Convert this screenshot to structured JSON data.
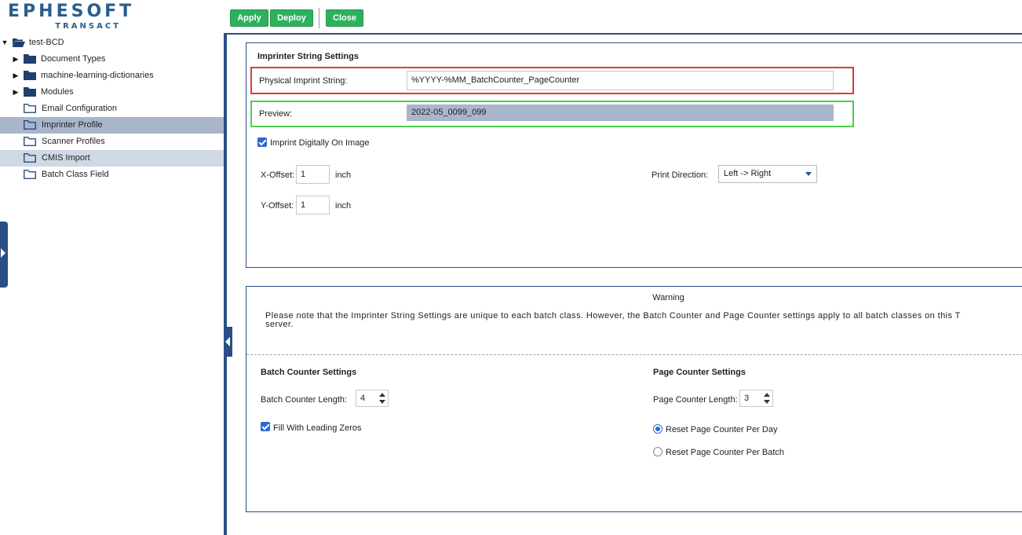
{
  "logo": {
    "word": "EPHESOFT",
    "sub": "TRANSACT"
  },
  "tree": {
    "root": "test-BCD",
    "items": [
      {
        "label": "Document Types",
        "expandable": true
      },
      {
        "label": "machine-learning-dictionaries",
        "expandable": true
      },
      {
        "label": "Modules",
        "expandable": true
      },
      {
        "label": "Email Configuration",
        "expandable": false
      },
      {
        "label": "Imprinter Profile",
        "expandable": false
      },
      {
        "label": "Scanner Profiles",
        "expandable": false
      },
      {
        "label": "CMIS Import",
        "expandable": false
      },
      {
        "label": "Batch Class Field",
        "expandable": false
      }
    ]
  },
  "toolbar": {
    "apply": "Apply",
    "deploy": "Deploy",
    "close": "Close"
  },
  "imprinter": {
    "title": "Imprinter String Settings",
    "physical_label": "Physical Imprint String:",
    "physical_value": "%YYYY-%MM_BatchCounter_PageCounter",
    "preview_label": "Preview:",
    "preview_value": "2022-05_0099_099",
    "digital_label": "Imprint Digitally On Image",
    "digital_checked": true,
    "xoffset_label": "X-Offset:",
    "xoffset_value": "1",
    "yoffset_label": "Y-Offset:",
    "yoffset_value": "1",
    "unit": "inch",
    "direction_label": "Print Direction:",
    "direction_value": "Left -> Right"
  },
  "warning": {
    "title": "Warning",
    "line1": "Please note that the Imprinter String Settings are unique to each batch class. However, the Batch Counter and Page Counter settings apply to all batch classes on this T",
    "line2": "server."
  },
  "batch_counter": {
    "title": "Batch Counter Settings",
    "length_label": "Batch Counter Length:",
    "length_value": "4",
    "fill_label": "Fill With Leading Zeros",
    "fill_checked": true
  },
  "page_counter": {
    "title": "Page Counter Settings",
    "length_label": "Page Counter Length:",
    "length_value": "3",
    "reset_day_label": "Reset Page Counter Per Day",
    "reset_batch_label": "Reset Page Counter Per Batch",
    "selected_reset": "day"
  },
  "colors": {
    "brand": "#2a5d8f",
    "divider": "#2a4f86",
    "button_green": "#2eb15e",
    "selection": "#a8b6cc",
    "highlight_red": "#e03a3a",
    "highlight_green": "#4cd14c",
    "checkbox_blue": "#2a6ad1"
  }
}
